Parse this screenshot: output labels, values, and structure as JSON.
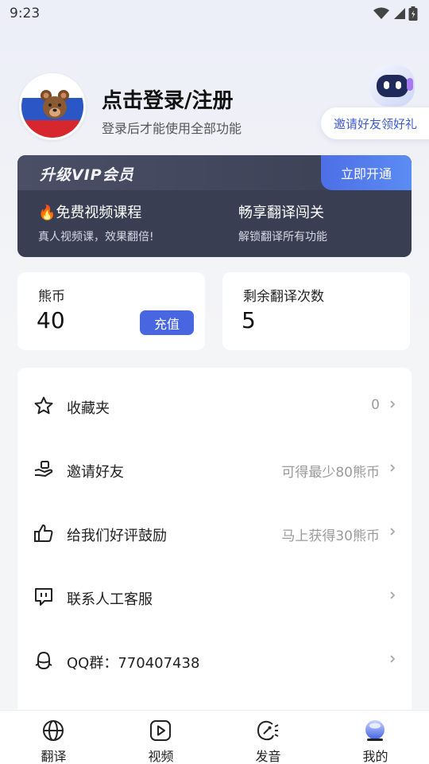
{
  "status_bar": {
    "time": "9:23"
  },
  "profile": {
    "title": "点击登录/注册",
    "subtitle": "登录后才能使用全部功能"
  },
  "invite_pill": {
    "label": "邀请好友领好礼"
  },
  "vip": {
    "title": "升级VIP会员",
    "open_button": "立即开通",
    "features": [
      {
        "title": "🔥免费视频课程",
        "desc": "真人视频课，效果翻倍!"
      },
      {
        "title": "畅享翻译闯关",
        "desc": "解锁翻译所有功能"
      }
    ]
  },
  "stats": {
    "coins": {
      "label": "熊币",
      "value": "40",
      "button": "充值"
    },
    "translations": {
      "label": "剩余翻译次数",
      "value": "5"
    }
  },
  "menu": [
    {
      "icon": "star-icon",
      "label": "收藏夹",
      "value": "0"
    },
    {
      "icon": "gift-hand-icon",
      "label": "邀请好友",
      "value": "可得最少80熊币"
    },
    {
      "icon": "thumbs-up-icon",
      "label": "给我们好评鼓励",
      "value": "马上获得30熊币"
    },
    {
      "icon": "chat-support-icon",
      "label": "联系人工客服",
      "value": ""
    },
    {
      "icon": "penguin-icon",
      "label": "QQ群：770407438",
      "value": ""
    }
  ],
  "tabs": [
    {
      "icon": "globe-icon",
      "label": "翻译",
      "active": false
    },
    {
      "icon": "video-play-icon",
      "label": "视频",
      "active": false
    },
    {
      "icon": "pronunciation-icon",
      "label": "发音",
      "active": false
    },
    {
      "icon": "profile-orb-icon",
      "label": "我的",
      "active": true
    }
  ],
  "colors": {
    "accent": "#4766e0",
    "vip_bg": "#3a3e52",
    "invite_text": "#3d5bd0"
  }
}
